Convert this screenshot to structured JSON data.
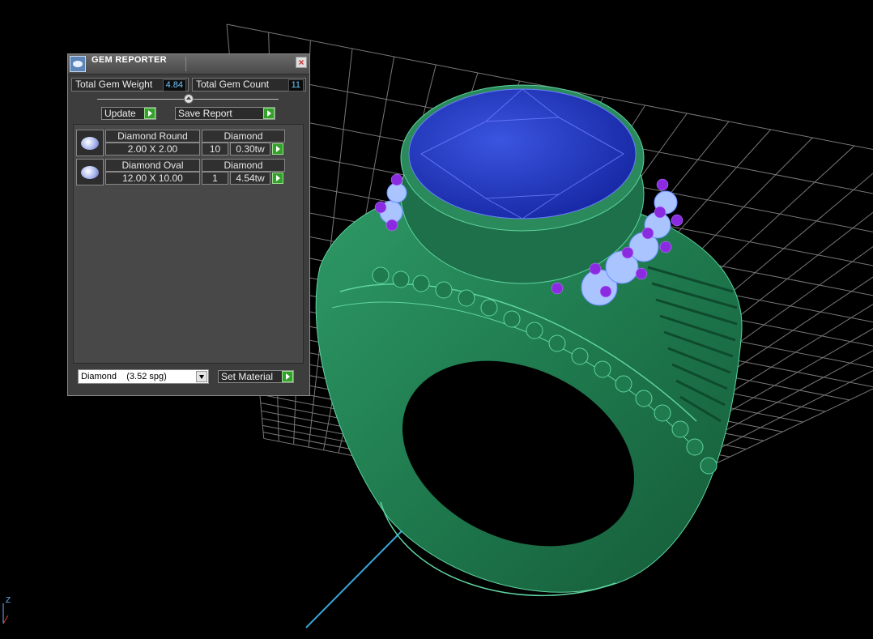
{
  "panel": {
    "title": "GEM REPORTER",
    "close_label": "×",
    "total_weight_label": "Total Gem Weight",
    "total_weight_value": "4.84",
    "total_count_label": "Total Gem Count",
    "total_count_value": "11",
    "update_label": "Update",
    "save_report_label": "Save Report",
    "gems": [
      {
        "name": "Diamond Round",
        "size": "2.00 X 2.00",
        "material": "Diamond",
        "count": "10",
        "weight": "0.30tw"
      },
      {
        "name": "Diamond Oval",
        "size": "12.00 X 10.00",
        "material": "Diamond",
        "count": "1",
        "weight": "4.54tw"
      }
    ],
    "material_select_value": "Diamond    (3.52 spg)",
    "set_material_label": "Set Material"
  },
  "viewport": {
    "axis_label": "Z",
    "colors": {
      "background": "#000000",
      "grid": "#9a9a9a",
      "ring": "#1f7a4e",
      "center_stone": "#1b2fb0",
      "side_stone": "#a9c4ff",
      "accent_stone": "#8a2be2"
    }
  }
}
